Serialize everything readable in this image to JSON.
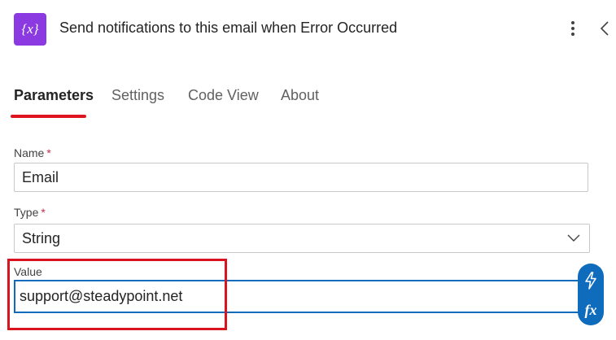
{
  "header": {
    "icon": "variable-icon",
    "icon_color": "#8a3ae0",
    "title": "Send notifications to this email when Error Occurred",
    "more_icon": "more-vertical-icon",
    "collapse_icon": "chevron-left-icon"
  },
  "tabs": [
    {
      "label": "Parameters",
      "active": true
    },
    {
      "label": "Settings",
      "active": false
    },
    {
      "label": "Code View",
      "active": false
    },
    {
      "label": "About",
      "active": false
    }
  ],
  "accent_color": "#e0141e",
  "fields": {
    "name": {
      "label": "Name",
      "required_mark": "*",
      "value": "Email"
    },
    "type": {
      "label": "Type",
      "required_mark": "*",
      "selected": "String"
    },
    "value": {
      "label": "Value",
      "value": "support@steadypoint.net"
    }
  },
  "side_buttons": {
    "dynamic_content_icon": "lightning-icon",
    "expression_label": "fx"
  }
}
